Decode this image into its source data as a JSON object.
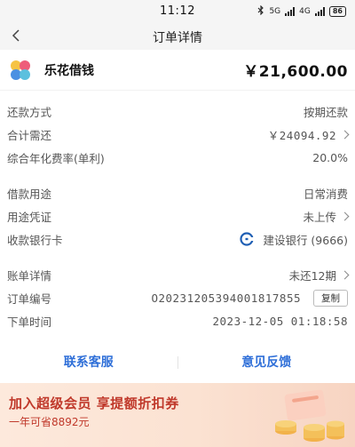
{
  "status": {
    "time": "11:12",
    "net_label": "5G",
    "net_label2": "4G",
    "battery": "86"
  },
  "nav": {
    "title": "订单详情"
  },
  "merchant": {
    "name": "乐花借钱",
    "amount": "￥21,600.00",
    "logo_colors": [
      "#f6c343",
      "#ee5d7a",
      "#4a90e2",
      "#5bc0de"
    ]
  },
  "rows": {
    "repay_method": {
      "label": "还款方式",
      "value": "按期还款"
    },
    "total_due": {
      "label": "合计需还",
      "value": "￥24094.92"
    },
    "annual_rate": {
      "label": "综合年化费率(单利)",
      "value": "20.0%"
    },
    "purpose": {
      "label": "借款用途",
      "value": "日常消费"
    },
    "voucher": {
      "label": "用途凭证",
      "value": "未上传"
    },
    "bank_card": {
      "label": "收款银行卡",
      "value": "建设银行 (9666)"
    },
    "bill": {
      "label": "账单详情",
      "value": "未还12期"
    },
    "order_no": {
      "label": "订单编号",
      "value": "O20231205394001817855",
      "copy": "复制"
    },
    "order_time": {
      "label": "下单时间",
      "value": "2023-12-05 01:18:58"
    }
  },
  "actions": {
    "contact": "联系客服",
    "feedback": "意见反馈"
  },
  "banner": {
    "title": "加入超级会员 享提额折扣券",
    "subtitle": "一年可省8892元"
  },
  "colors": {
    "accent": "#2f6fd8",
    "banner_text": "#c0392b",
    "bank_blue": "#1f5fb4"
  }
}
